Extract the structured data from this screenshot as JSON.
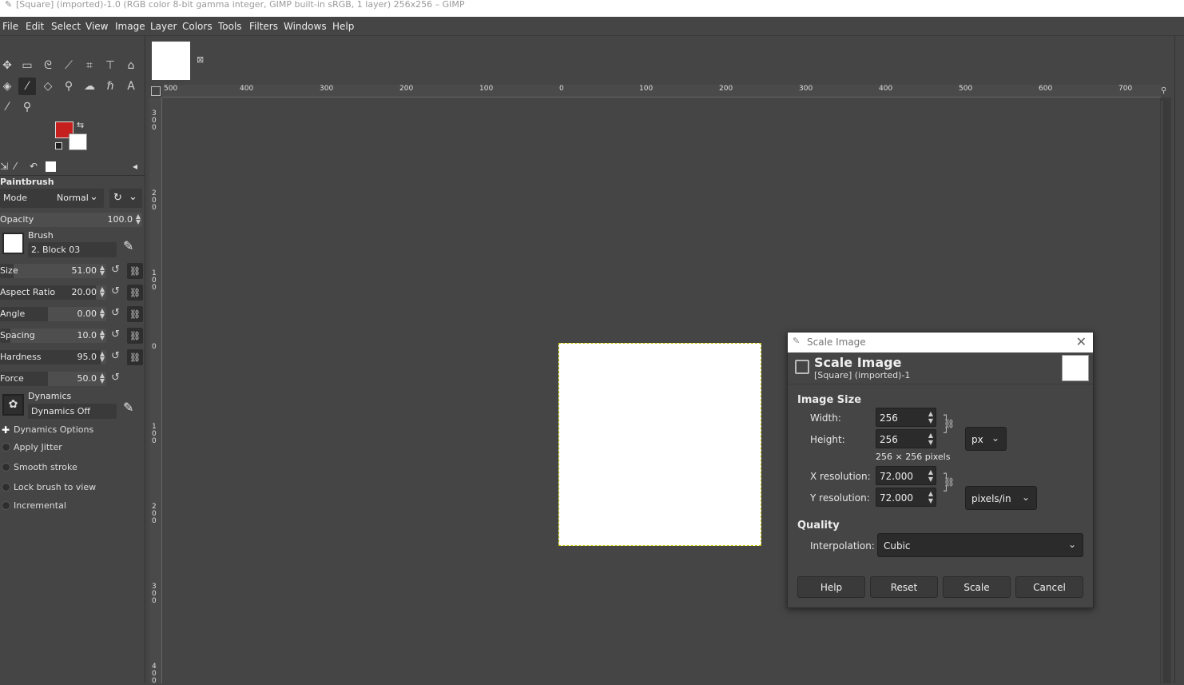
{
  "window": {
    "title": "[Square] (imported)-1.0 (RGB color 8-bit gamma integer, GIMP built-in sRGB, 1 layer) 256x256 – GIMP"
  },
  "menu": [
    "File",
    "Edit",
    "Select",
    "View",
    "Image",
    "Layer",
    "Colors",
    "Tools",
    "Filters",
    "Windows",
    "Help"
  ],
  "tool_options": {
    "tool_name": "Paintbrush",
    "mode_label": "Mode",
    "mode_value": "Normal",
    "opacity_label": "Opacity",
    "opacity_value": "100.0",
    "brush_label": "Brush",
    "brush_value": "2. Block 03",
    "sliders": [
      {
        "label": "Size",
        "value": "51.00"
      },
      {
        "label": "Aspect Ratio",
        "value": "20.00"
      },
      {
        "label": "Angle",
        "value": "0.00"
      },
      {
        "label": "Spacing",
        "value": "10.0"
      },
      {
        "label": "Hardness",
        "value": "95.0"
      },
      {
        "label": "Force",
        "value": "50.0"
      }
    ],
    "dynamics_label": "Dynamics",
    "dynamics_value": "Dynamics Off",
    "dynamics_options": "Dynamics Options",
    "checkboxes": [
      "Apply Jitter",
      "Smooth stroke",
      "Lock brush to view",
      "Incremental"
    ]
  },
  "colors": {
    "foreground": "#c6201e",
    "background": "#ffffff"
  },
  "ruler": {
    "h_labels": [
      "500",
      "400",
      "300",
      "200",
      "100",
      "0",
      "100",
      "200",
      "300",
      "400",
      "500",
      "600",
      "700"
    ],
    "v_labels": [
      "300",
      "200",
      "100",
      "0",
      "100",
      "200",
      "300",
      "400"
    ]
  },
  "dialog": {
    "window_title": "Scale Image",
    "header_title": "Scale Image",
    "header_subtitle": "[Square] (imported)-1",
    "image_size_section": "Image Size",
    "width_label": "Width:",
    "width_value": "256",
    "height_label": "Height:",
    "height_value": "256",
    "unit": "px",
    "pixels_info": "256 × 256 pixels",
    "xres_label": "X resolution:",
    "xres_value": "72.000",
    "yres_label": "Y resolution:",
    "yres_value": "72.000",
    "res_unit": "pixels/in",
    "quality_section": "Quality",
    "interp_label": "Interpolation:",
    "interp_value": "Cubic",
    "buttons": {
      "help": "Help",
      "reset": "Reset",
      "scale": "Scale",
      "cancel": "Cancel"
    }
  }
}
